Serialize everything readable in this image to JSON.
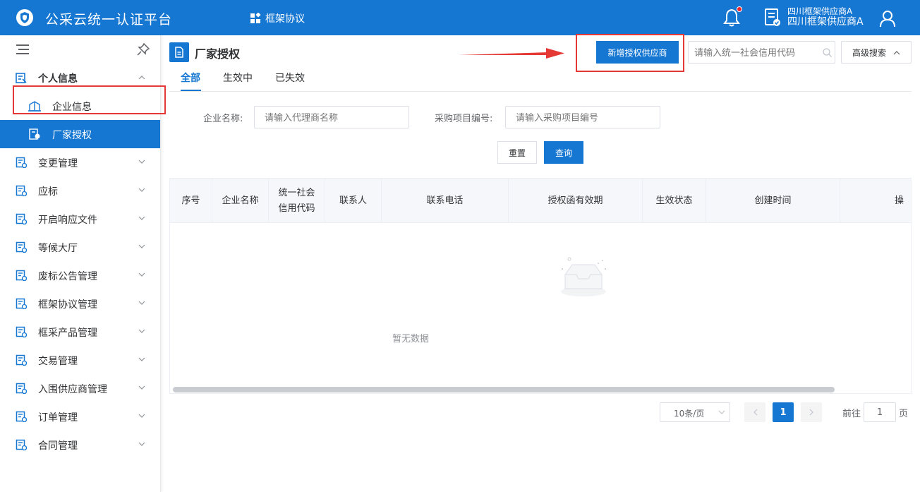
{
  "header": {
    "app_title": "公采云统一认证平台",
    "nav_label": "框架协议",
    "user_name_line1": "四川框架供应商A",
    "user_name_line2": "四川框架供应商A",
    "notification_dot": true
  },
  "sidebar": {
    "groups": [
      {
        "label": "个人信息",
        "icon": "person-card-icon",
        "expanded": true
      },
      {
        "label": "变更管理",
        "icon": "change-icon"
      },
      {
        "label": "应标",
        "icon": "bid-icon"
      },
      {
        "label": "开启响应文件",
        "icon": "file-open-icon"
      },
      {
        "label": "等候大厅",
        "icon": "hall-icon"
      },
      {
        "label": "废标公告管理",
        "icon": "notice-icon"
      },
      {
        "label": "框架协议管理",
        "icon": "agreement-icon"
      },
      {
        "label": "框采产品管理",
        "icon": "product-icon"
      },
      {
        "label": "交易管理",
        "icon": "trade-icon"
      },
      {
        "label": "入围供应商管理",
        "icon": "supplier-icon"
      },
      {
        "label": "订单管理",
        "icon": "order-icon"
      },
      {
        "label": "合同管理",
        "icon": "contract-icon"
      }
    ],
    "sub_items": [
      {
        "label": "企业信息",
        "icon": "building-icon"
      },
      {
        "label": "厂家授权",
        "icon": "authorize-icon",
        "active": true
      }
    ]
  },
  "page": {
    "title": "厂家授权",
    "tabs": [
      "全部",
      "生效中",
      "已失效"
    ],
    "active_tab": "全部",
    "add_button_label": "新增授权供应商",
    "code_search_placeholder": "请输入统一社会信用代码",
    "advanced_search_label": "高级搜索"
  },
  "filters": {
    "company_label": "企业名称:",
    "company_placeholder": "请输入代理商名称",
    "project_label": "采购项目编号:",
    "project_placeholder": "请输入采购项目编号",
    "reset_label": "重置",
    "query_label": "查询"
  },
  "table": {
    "columns": [
      "序号",
      "企业名称",
      "统一社会信用代码",
      "联系人",
      "联系电话",
      "授权函有效期",
      "生效状态",
      "创建时间",
      "操"
    ],
    "column_wrapped": {
      "line1": "统一社会",
      "line2": "信用代码"
    },
    "empty_text": "暂无数据"
  },
  "pagination": {
    "page_size": "10条/页",
    "current_page": "1",
    "goto_label": "前往",
    "goto_value": "1",
    "page_suffix": "页"
  },
  "colors": {
    "primary": "#1677d2",
    "highlight_box": "#e53935"
  }
}
